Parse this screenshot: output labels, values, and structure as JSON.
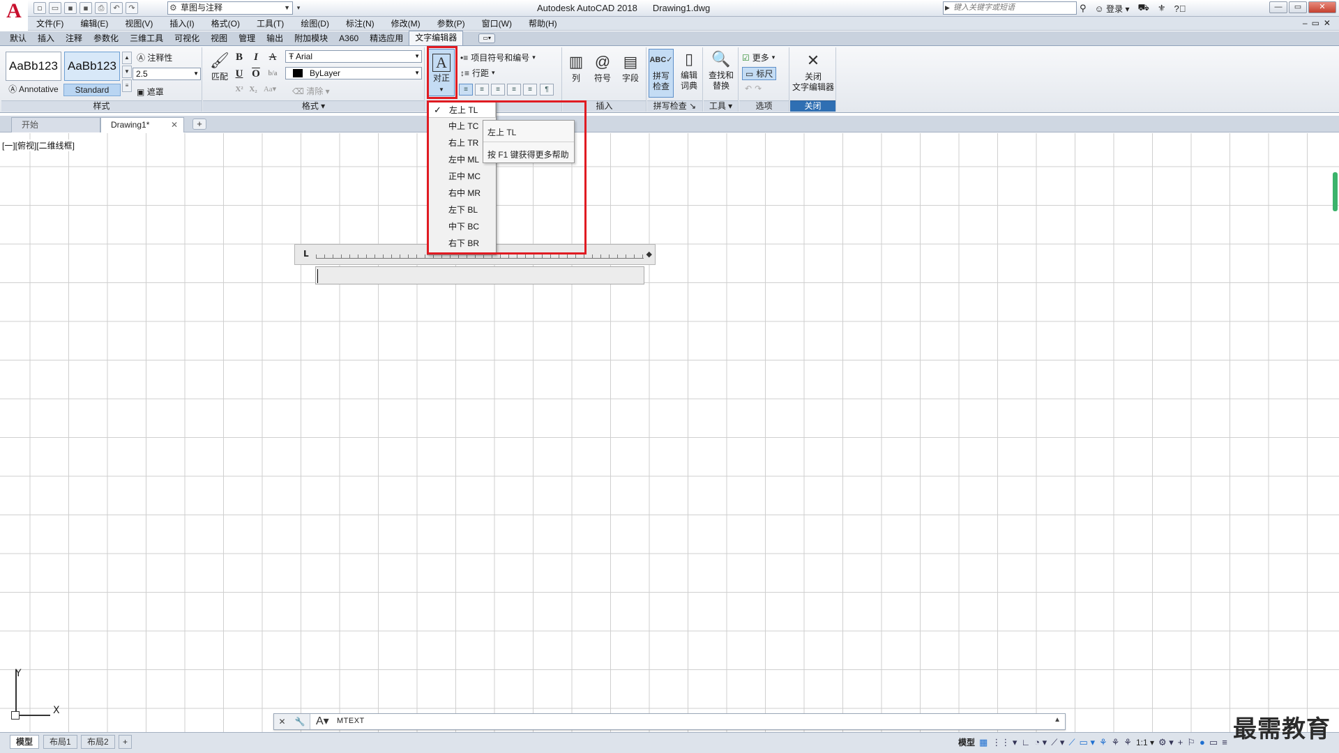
{
  "titlebar": {
    "app_title": "Autodesk AutoCAD 2018",
    "doc_title": "Drawing1.dwg",
    "workspace": "草图与注释",
    "search_placeholder": "键入关键字或短语",
    "login": "登录"
  },
  "menu": [
    "文件(F)",
    "编辑(E)",
    "视图(V)",
    "插入(I)",
    "格式(O)",
    "工具(T)",
    "绘图(D)",
    "标注(N)",
    "修改(M)",
    "参数(P)",
    "窗口(W)",
    "帮助(H)"
  ],
  "ribbon_tabs": [
    "默认",
    "插入",
    "注释",
    "参数化",
    "三维工具",
    "可视化",
    "视图",
    "管理",
    "输出",
    "附加模块",
    "A360",
    "精选应用",
    "文字编辑器"
  ],
  "ribbon": {
    "style_panel": {
      "title": "样式",
      "style1": "AaBb123",
      "style1_name": "Annotative",
      "style2": "AaBb123",
      "style2_name": "Standard",
      "annotative": "注释性",
      "height": "2.5",
      "mask": "遮罩"
    },
    "format_panel": {
      "title": "格式",
      "match": "匹配",
      "font": "Arial",
      "color": "ByLayer",
      "clear": "清除",
      "bold": "B",
      "italic": "I",
      "strike": "A",
      "underline": "U",
      "overline": "O",
      "case": "Aa"
    },
    "paragraph_panel": {
      "justify": "对正",
      "bullets": "项目符号和编号",
      "line_spacing": "行距"
    },
    "insert_panel": {
      "title": "插入",
      "columns": "列",
      "symbol": "符号",
      "field": "字段"
    },
    "spell_panel": {
      "title": "拼写检查",
      "spell": "拼写\n检查",
      "dictionary": "编辑\n词典"
    },
    "tools_panel": {
      "title": "工具",
      "find_replace": "查找和\n替换"
    },
    "options_panel": {
      "title": "选项",
      "more": "更多",
      "ruler": "标尺"
    },
    "close_panel": {
      "title": "关闭",
      "close": "关闭\n文字编辑器"
    }
  },
  "file_tabs": {
    "start": "开始",
    "drawing": "Drawing1*"
  },
  "viewport_label": "[一][俯视][二维线框]",
  "justify_menu": {
    "checked_index": 0,
    "items": [
      "左上 TL",
      "中上 TC",
      "右上 TR",
      "左中 ML",
      "正中 MC",
      "右中 MR",
      "左下 BL",
      "中下 BC",
      "右下 BR"
    ]
  },
  "tooltip": {
    "title": "左上 TL",
    "help": "按 F1 键获得更多帮助"
  },
  "ucs": {
    "x": "X",
    "y": "Y"
  },
  "command_line": {
    "text": "MTEXT"
  },
  "layout_tabs": [
    "模型",
    "布局1",
    "布局2"
  ],
  "status": {
    "model": "模型",
    "scale": "1:1"
  },
  "watermark": "最需教育"
}
